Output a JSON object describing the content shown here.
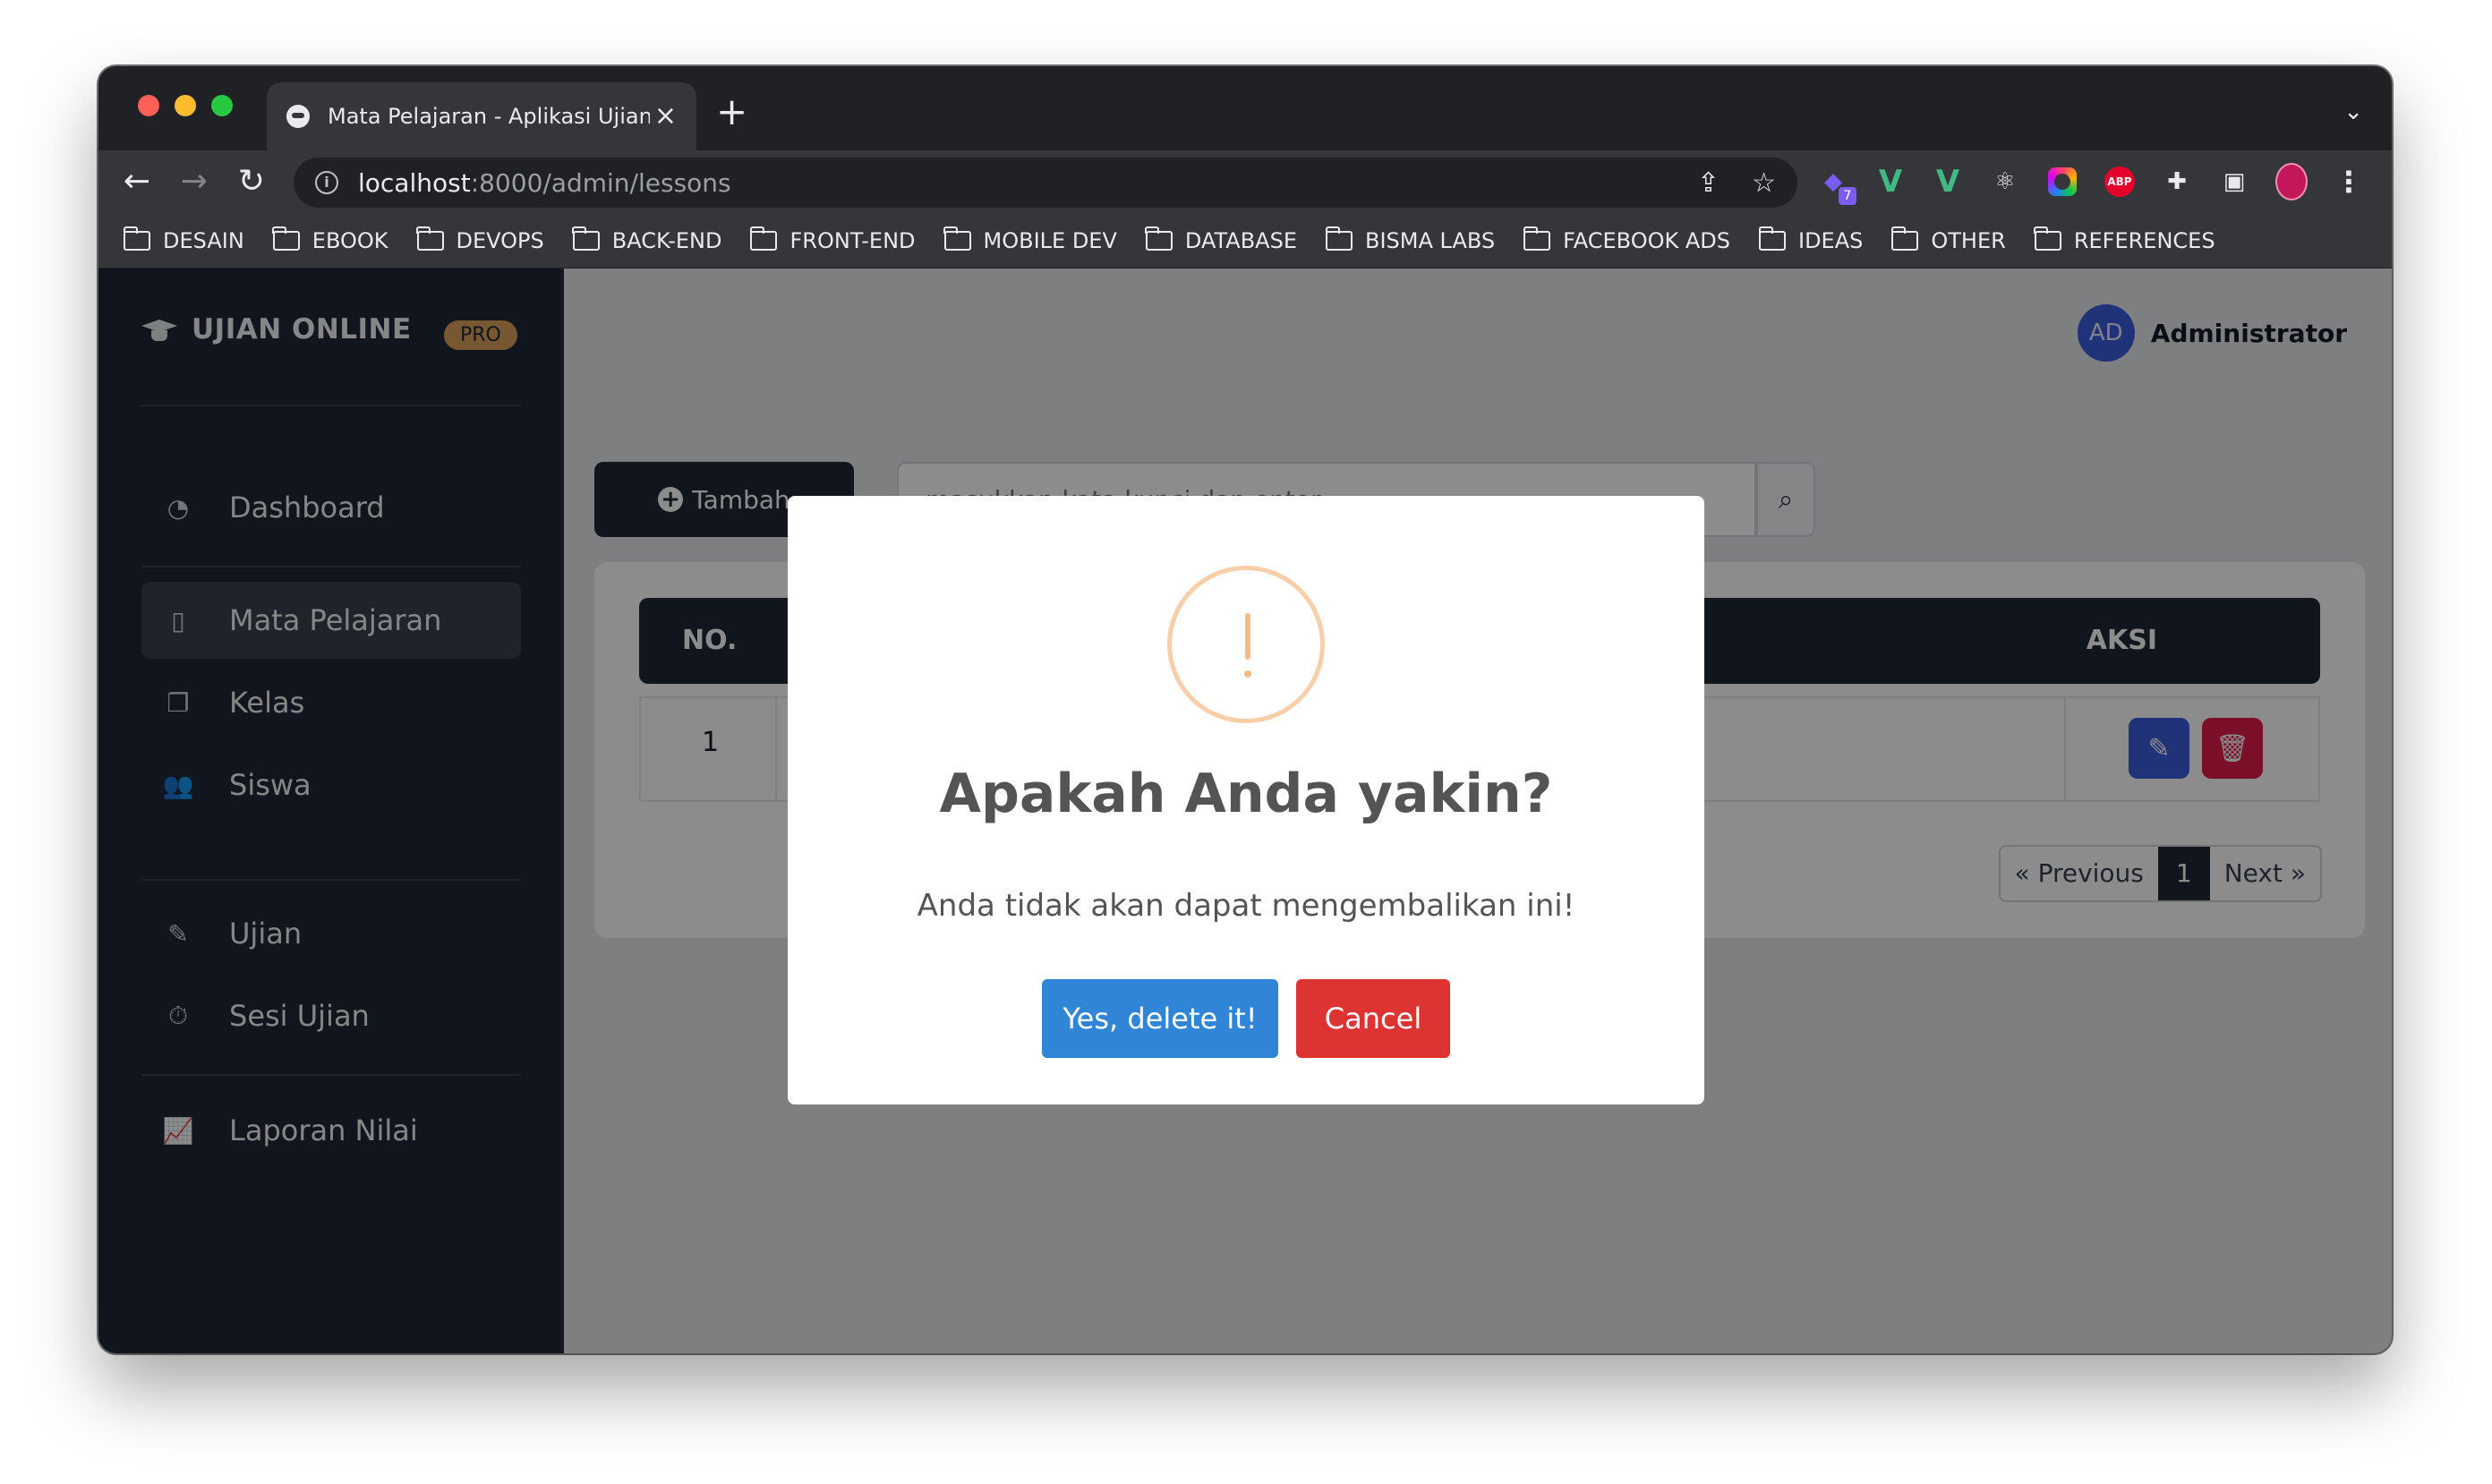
{
  "browser": {
    "tab_title": "Mata Pelajaran - Aplikasi Ujian Online",
    "url_host": "localhost",
    "url_rest": ":8000/admin/lessons",
    "extension_badge": "7",
    "abp_label": "ABP"
  },
  "bookmarks": [
    "DESAIN",
    "EBOOK",
    "DEVOPS",
    "BACK-END",
    "FRONT-END",
    "MOBILE DEV",
    "DATABASE",
    "BISMA LABS",
    "FACEBOOK ADS",
    "IDEAS",
    "OTHER",
    "REFERENCES"
  ],
  "sidebar": {
    "brand": "UJIAN ONLINE",
    "badge": "PRO",
    "items": [
      {
        "label": "Dashboard",
        "icon": "gauge-icon"
      },
      {
        "label": "Mata Pelajaran",
        "icon": "bookmark-icon",
        "active": true
      },
      {
        "label": "Kelas",
        "icon": "copy-icon"
      },
      {
        "label": "Siswa",
        "icon": "users-icon"
      },
      {
        "label": "Ujian",
        "icon": "edit-icon"
      },
      {
        "label": "Sesi Ujian",
        "icon": "stopwatch-icon"
      },
      {
        "label": "Laporan Nilai",
        "icon": "chart-line-icon"
      }
    ]
  },
  "header": {
    "avatar_initials": "AD",
    "user_name": "Administrator"
  },
  "toolbar": {
    "add_label": "Tambah",
    "search_placeholder": "masukkan kata kunci dan enter..."
  },
  "table": {
    "headers": {
      "no": "NO.",
      "aksi": "AKSI"
    },
    "rows": [
      {
        "no": "1"
      }
    ]
  },
  "pagination": {
    "previous": "« Previous",
    "current": "1",
    "next": "Next »"
  },
  "modal": {
    "title": "Apakah Anda yakin?",
    "text": "Anda tidak akan dapat mengembalikan ini!",
    "confirm_label": "Yes, delete it!",
    "cancel_label": "Cancel",
    "confirm_color": "#3085d6",
    "cancel_color": "#dd3333"
  }
}
